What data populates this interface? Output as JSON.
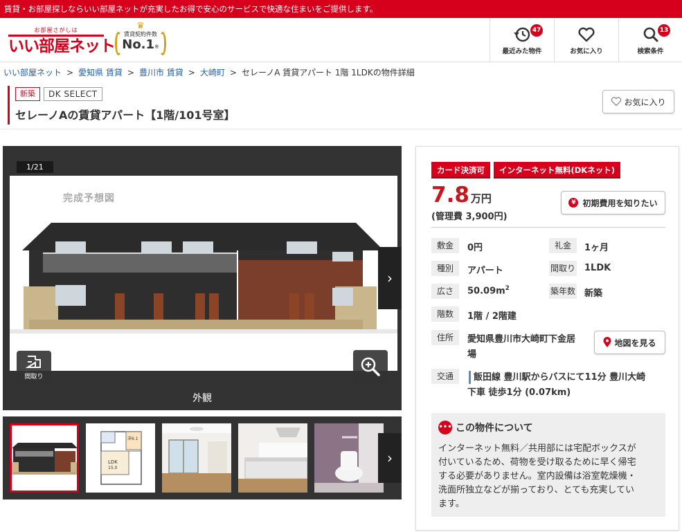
{
  "topbar": {
    "text": "賃貸・お部屋探しならいい部屋ネットが充実したお得で安心のサービスで快適な住まいをご提供します。"
  },
  "logo": {
    "tagline": "お部屋さがしは",
    "name": "いい部屋ネット"
  },
  "award": {
    "caption": "賃貸契約件数",
    "rank": "No.1",
    "note": "※"
  },
  "header_nav": [
    {
      "label": "最近みた物件",
      "count": "47",
      "icon": "history-icon"
    },
    {
      "label": "お気に入り",
      "count": "",
      "icon": "heart-icon"
    },
    {
      "label": "検索条件",
      "count": "13",
      "icon": "search-icon"
    }
  ],
  "breadcrumb": {
    "items": [
      "いい部屋ネット",
      "愛知県 賃貸",
      "豊川市 賃貸",
      "大崎町"
    ],
    "current": "セレーノA 賃貸アパート 1階 1LDKの物件詳細",
    "separator": ">"
  },
  "property": {
    "tag_new": "新築",
    "tag_brand": "DK SELECT",
    "title": "セレーノAの賃貸アパート【1階/101号室】",
    "favorite_label": "お気に入り"
  },
  "gallery": {
    "counter": "1/21",
    "watermark": "完成予想図",
    "caption": "外観",
    "floorplan_label": "間取り",
    "thumb_plan_text": {
      "ldk": "LDK",
      "ldk_size": "15.0",
      "room": "洋6.1"
    }
  },
  "panel": {
    "badges": [
      "カード決済可",
      "インターネット無料(DKネット)"
    ],
    "rent_value": "7.8",
    "rent_unit": "万円",
    "management_fee": "(管理費 3,900円)",
    "cost_button": "初期費用を知りたい",
    "specs": {
      "deposit_label": "敷金",
      "deposit": "0円",
      "key_money_label": "礼金",
      "key_money": "1ヶ月",
      "type_label": "種別",
      "type": "アパート",
      "layout_label": "間取り",
      "layout": "1LDK",
      "area_label": "広さ",
      "area": "50.09m",
      "area_sup": "2",
      "age_label": "築年数",
      "age": "新築",
      "floor_label": "階数",
      "floor": "1階 / 2階建",
      "address_label": "住所",
      "address_line1": "愛知県豊川市大崎町下金居",
      "address_line2": "場",
      "transit_label": "交通",
      "transit_line1": "飯田線 豊川駅からバスにて11分 豊川大崎",
      "transit_line2": "下車 徒歩1分 (0.07km)"
    },
    "map_button": "地図を見る",
    "about_title": "この物件について",
    "about_lines": [
      "インターネット無料／共用部には宅配ボックスが",
      "付いているため、荷物を受け取るために早く帰宅",
      "する必要がありません。室内設備は浴室乾燥機・",
      "洗面所独立などが揃っており、とても充実してい",
      "ます。"
    ]
  },
  "colors": {
    "brand_red": "#d6001c",
    "link_blue": "#1d5fa8",
    "price_red": "#c8161d"
  }
}
